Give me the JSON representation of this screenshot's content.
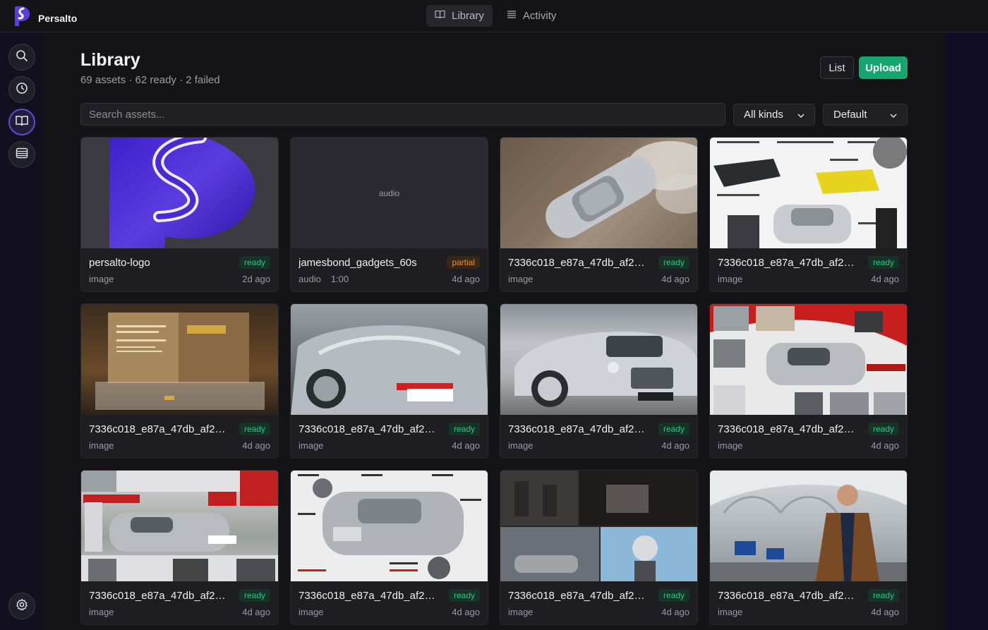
{
  "app": {
    "name": "Persalto"
  },
  "topnav": {
    "items": [
      {
        "label": "Library",
        "icon": "book-icon",
        "active": true
      },
      {
        "label": "Activity",
        "icon": "list-icon",
        "active": false
      }
    ]
  },
  "rail": {
    "items": [
      {
        "icon": "search-icon"
      },
      {
        "icon": "clock-icon"
      },
      {
        "icon": "book-icon",
        "active": true
      },
      {
        "icon": "stack-icon"
      }
    ],
    "settings_icon": "gear-icon"
  },
  "page": {
    "title": "Library",
    "subtitle": "69 assets · 62 ready · 2 failed",
    "list_label": "List",
    "upload_label": "Upload"
  },
  "search": {
    "placeholder": "Search assets..."
  },
  "filters": {
    "kind": "All kinds",
    "sort": "Default"
  },
  "colors": {
    "accent": "#15a56e",
    "brand": "#5b3ce0",
    "ready": "#2ec483",
    "partial": "#e8913a"
  },
  "assets": [
    {
      "name": "persalto-logo",
      "status": "ready",
      "kind": "image",
      "duration": "",
      "age": "2d ago"
    },
    {
      "name": "jamesbond_gadgets_60s",
      "status": "partial",
      "kind": "audio",
      "duration": "1:00",
      "age": "4d ago",
      "placeholder": "audio"
    },
    {
      "name": "7336c018_e87a_47db_af2e_2...",
      "status": "ready",
      "kind": "image",
      "duration": "",
      "age": "4d ago"
    },
    {
      "name": "7336c018_e87a_47db_af2e_2...",
      "status": "ready",
      "kind": "image",
      "duration": "",
      "age": "4d ago"
    },
    {
      "name": "7336c018_e87a_47db_af2e_2...",
      "status": "ready",
      "kind": "image",
      "duration": "",
      "age": "4d ago"
    },
    {
      "name": "7336c018_e87a_47db_af2e_2...",
      "status": "ready",
      "kind": "image",
      "duration": "",
      "age": "4d ago"
    },
    {
      "name": "7336c018_e87a_47db_af2e_2...",
      "status": "ready",
      "kind": "image",
      "duration": "",
      "age": "4d ago"
    },
    {
      "name": "7336c018_e87a_47db_af2e_2...",
      "status": "ready",
      "kind": "image",
      "duration": "",
      "age": "4d ago"
    },
    {
      "name": "7336c018_e87a_47db_af2e_2...",
      "status": "ready",
      "kind": "image",
      "duration": "",
      "age": "4d ago"
    },
    {
      "name": "7336c018_e87a_47db_af2e_2...",
      "status": "ready",
      "kind": "image",
      "duration": "",
      "age": "4d ago"
    },
    {
      "name": "7336c018_e87a_47db_af2e_2...",
      "status": "ready",
      "kind": "image",
      "duration": "",
      "age": "4d ago"
    },
    {
      "name": "7336c018_e87a_47db_af2e_2...",
      "status": "ready",
      "kind": "image",
      "duration": "",
      "age": "4d ago"
    }
  ]
}
